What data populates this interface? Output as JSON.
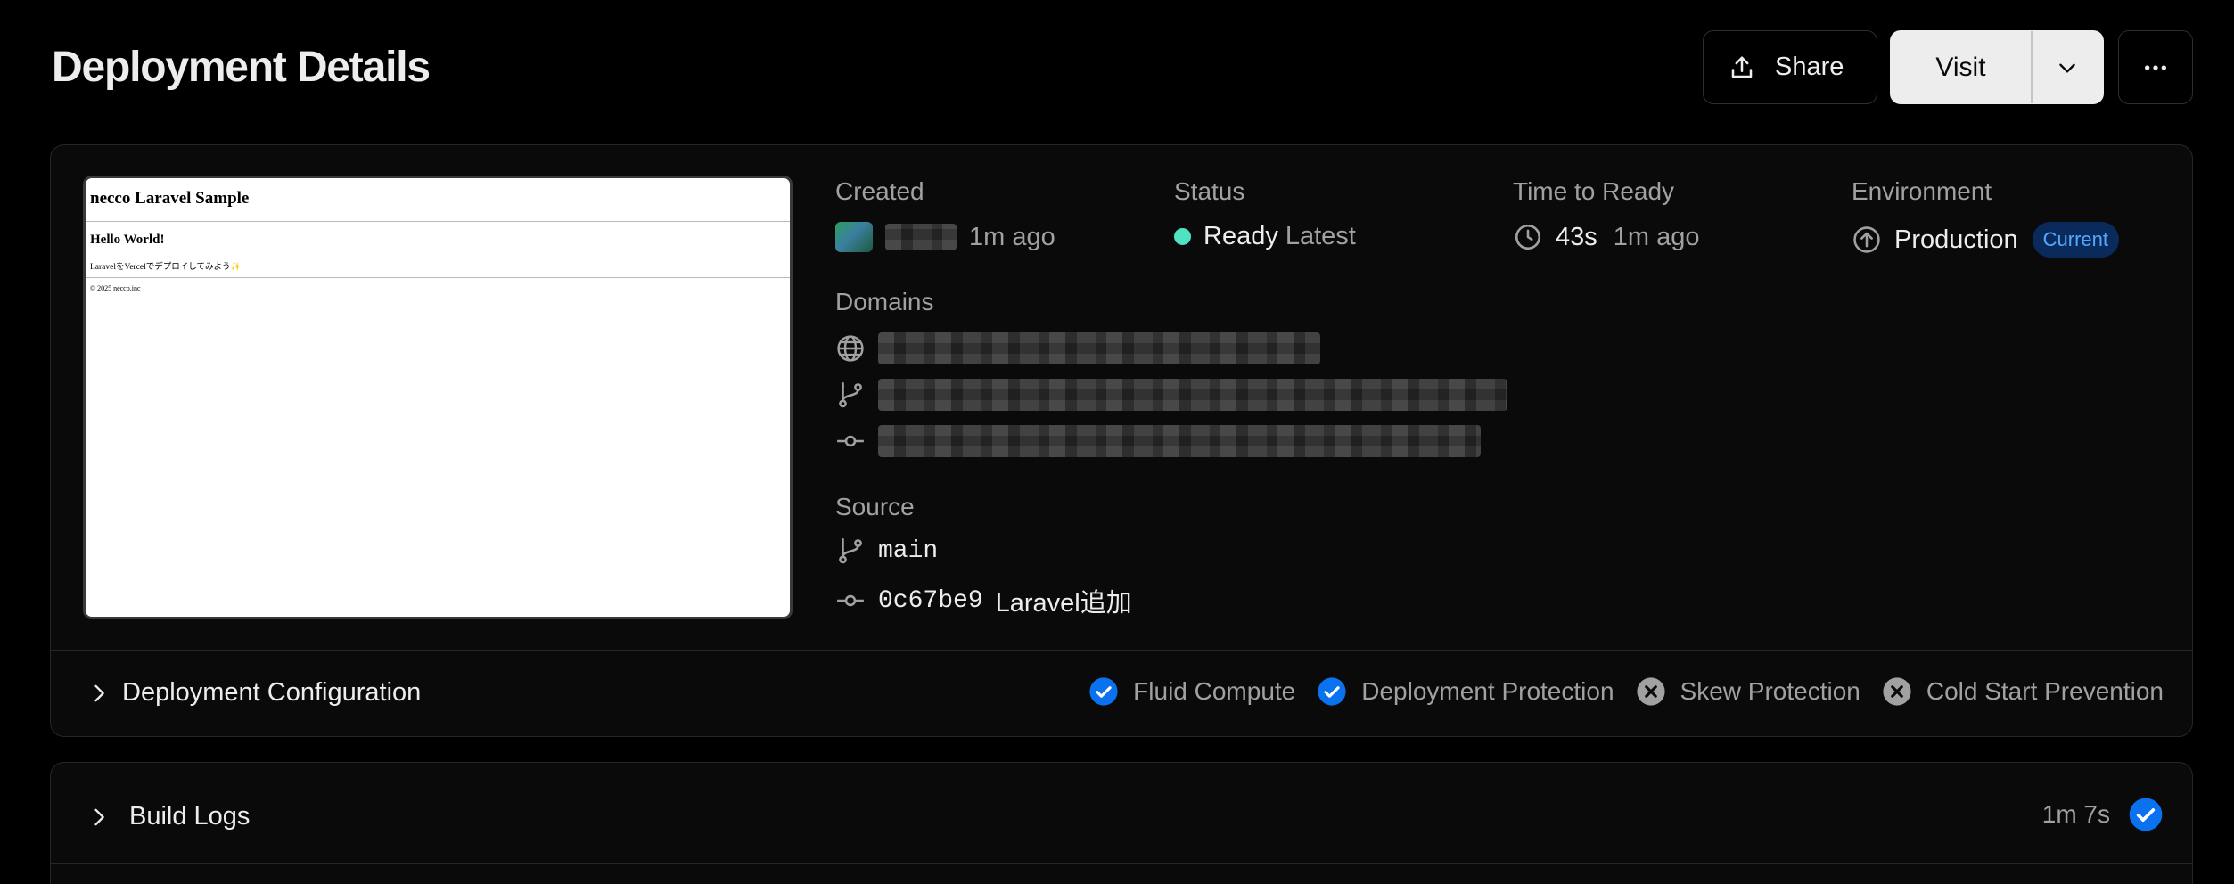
{
  "header": {
    "title": "Deployment Details",
    "share_label": "Share",
    "visit_label": "Visit"
  },
  "preview": {
    "site_title": "necco Laravel Sample",
    "heading": "Hello World!",
    "paragraph": "LaravelをVercelでデプロイしてみよう✨",
    "footer": "© 2025 necco.inc"
  },
  "details": {
    "created": {
      "label": "Created",
      "time": "1m ago"
    },
    "status": {
      "label": "Status",
      "value": "Ready",
      "tag": "Latest",
      "color": "#50e3c2"
    },
    "time_to_ready": {
      "label": "Time to Ready",
      "duration": "43s",
      "ago": "1m ago"
    },
    "environment": {
      "label": "Environment",
      "value": "Production",
      "badge": "Current"
    },
    "domains": {
      "label": "Domains"
    },
    "source": {
      "label": "Source",
      "branch": "main",
      "commit_hash": "0c67be9",
      "commit_message": "Laravel追加"
    }
  },
  "configuration": {
    "title": "Deployment Configuration",
    "features": [
      {
        "label": "Fluid Compute",
        "enabled": true
      },
      {
        "label": "Deployment Protection",
        "enabled": true
      },
      {
        "label": "Skew Protection",
        "enabled": false
      },
      {
        "label": "Cold Start Prevention",
        "enabled": false
      }
    ]
  },
  "build_logs": {
    "title": "Build Logs",
    "duration": "1m 7s"
  },
  "colors": {
    "accent_blue": "#0a72ef",
    "ready_green": "#50e3c2",
    "badge_bg": "#0b2a5c",
    "badge_text": "#52a8ff"
  }
}
